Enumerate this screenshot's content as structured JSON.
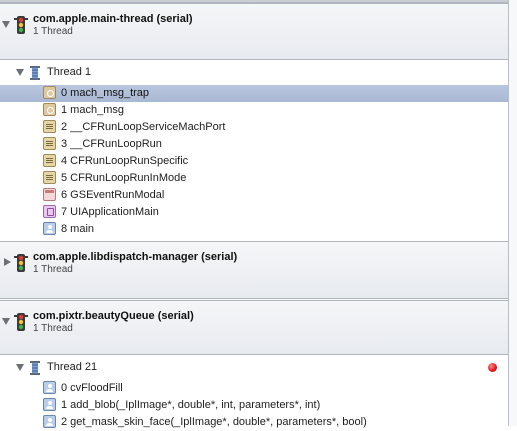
{
  "queues": [
    {
      "title": "com.apple.main-thread (serial)",
      "subtitle": "1 Thread",
      "expanded": true,
      "thread": {
        "label": "Thread 1",
        "frames": [
          {
            "label": "0 mach_msg_trap",
            "icon": "gear-icon",
            "selected": true
          },
          {
            "label": "1 mach_msg",
            "icon": "gear-icon",
            "selected": false
          },
          {
            "label": "2 __CFRunLoopServiceMachPort",
            "icon": "list-icon",
            "selected": false
          },
          {
            "label": "3 __CFRunLoopRun",
            "icon": "list-icon",
            "selected": false
          },
          {
            "label": "4 CFRunLoopRunSpecific",
            "icon": "list-icon",
            "selected": false
          },
          {
            "label": "5 CFRunLoopRunInMode",
            "icon": "list-icon",
            "selected": false
          },
          {
            "label": "6 GSEventRunModal",
            "icon": "event-icon",
            "selected": false
          },
          {
            "label": "7 UIApplicationMain",
            "icon": "app-icon",
            "selected": false
          },
          {
            "label": "8 main",
            "icon": "user-icon",
            "selected": false
          }
        ]
      }
    },
    {
      "title": "com.apple.libdispatch-manager (serial)",
      "subtitle": "1 Thread",
      "expanded": false
    },
    {
      "title": "com.pixtr.beautyQueue (serial)",
      "subtitle": "1 Thread",
      "expanded": true,
      "thread": {
        "label": "Thread 21",
        "breakpoint": true,
        "frames": [
          {
            "label": "0 cvFloodFill",
            "icon": "user-icon",
            "selected": false
          },
          {
            "label": "1 add_blob(_IplImage*, double*, int, parameters*, int)",
            "icon": "user-icon",
            "selected": false
          },
          {
            "label": "2 get_mask_skin_face(_IplImage*, double*, parameters*, bool)",
            "icon": "user-icon",
            "selected": false
          }
        ]
      }
    }
  ],
  "colors": {
    "selection": "#b9c6de",
    "breakpoint": "#e0141a",
    "queue_header": "#eceef2"
  }
}
